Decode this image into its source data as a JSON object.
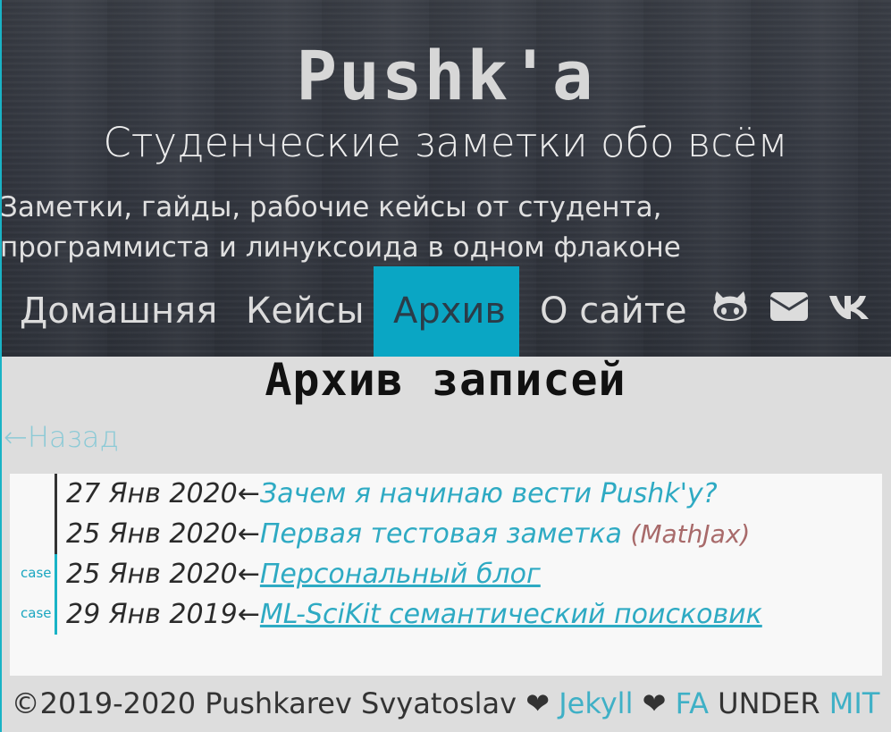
{
  "header": {
    "brand": "Pushk'a",
    "tagline": "Студенческие заметки обо всём",
    "description": "Заметки, гайды, рабочие кейсы от студента, программиста и линуксоида в одном флаконе"
  },
  "nav": {
    "items": [
      {
        "label": "Домашняя",
        "active": false
      },
      {
        "label": "Кейсы",
        "active": false
      },
      {
        "label": "Архив",
        "active": true
      },
      {
        "label": "О сайте",
        "active": false
      }
    ],
    "icons": [
      "github-icon",
      "envelope-icon",
      "vk-icon"
    ]
  },
  "main": {
    "heading": "Архив записей",
    "back_label": "←Назад",
    "posts": [
      {
        "tag": "",
        "date": "27 Янв 2020",
        "arrow": "←",
        "title": "Зачем я начинаю вести Pushk'у?",
        "note": ""
      },
      {
        "tag": "",
        "date": "25 Янв 2020",
        "arrow": "←",
        "title": "Первая тестовая заметка",
        "note": "(MathJax)"
      },
      {
        "tag": "case",
        "date": "25 Янв 2020",
        "arrow": "←",
        "title": "Персональный блог",
        "note": ""
      },
      {
        "tag": "case",
        "date": "29 Янв 2019",
        "arrow": "←",
        "title": "ML-SciKit семантический поисковик",
        "note": ""
      }
    ]
  },
  "footer": {
    "copyright": "©2019-2020 Pushkarev Svyatoslav",
    "heart": "❤",
    "jekyll": "Jekyll",
    "fa": "FA",
    "under": "UNDER",
    "mit": "MIT"
  },
  "colors": {
    "accent": "#0aa6c4",
    "link": "#2eaac3",
    "case_bar": "#19b3c6",
    "post_bar": "#333333"
  }
}
